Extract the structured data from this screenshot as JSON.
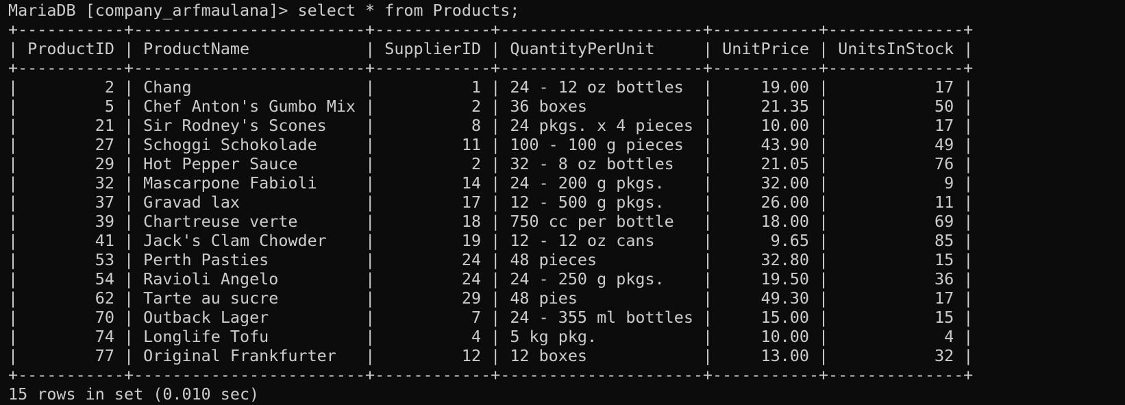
{
  "terminal": {
    "prompt": "MariaDB [company_arfmaulana]>",
    "command": "select * from Products;",
    "summary": "15 rows in set (0.010 sec)"
  },
  "table": {
    "columns": [
      {
        "name": "ProductID",
        "align": "right"
      },
      {
        "name": "ProductName",
        "align": "left"
      },
      {
        "name": "SupplierID",
        "align": "right"
      },
      {
        "name": "QuantityPerUnit",
        "align": "left"
      },
      {
        "name": "UnitPrice",
        "align": "right"
      },
      {
        "name": "UnitsInStock",
        "align": "right"
      }
    ],
    "rows": [
      [
        "2",
        "Chang",
        "1",
        "24 - 12 oz bottles",
        "19.00",
        "17"
      ],
      [
        "5",
        "Chef Anton's Gumbo Mix",
        "2",
        "36 boxes",
        "21.35",
        "50"
      ],
      [
        "21",
        "Sir Rodney's Scones",
        "8",
        "24 pkgs. x 4 pieces",
        "10.00",
        "17"
      ],
      [
        "27",
        "Schoggi Schokolade",
        "11",
        "100 - 100 g pieces",
        "43.90",
        "49"
      ],
      [
        "29",
        "Hot Pepper Sauce",
        "2",
        "32 - 8 oz bottles",
        "21.05",
        "76"
      ],
      [
        "32",
        "Mascarpone Fabioli",
        "14",
        "24 - 200 g pkgs.",
        "32.00",
        "9"
      ],
      [
        "37",
        "Gravad lax",
        "17",
        "12 - 500 g pkgs.",
        "26.00",
        "11"
      ],
      [
        "39",
        "Chartreuse verte",
        "18",
        "750 cc per bottle",
        "18.00",
        "69"
      ],
      [
        "41",
        "Jack's Clam Chowder",
        "19",
        "12 - 12 oz cans",
        "9.65",
        "85"
      ],
      [
        "53",
        "Perth Pasties",
        "24",
        "48 pieces",
        "32.80",
        "15"
      ],
      [
        "54",
        "Ravioli Angelo",
        "24",
        "24 - 250 g pkgs.",
        "19.50",
        "36"
      ],
      [
        "62",
        "Tarte au sucre",
        "29",
        "48 pies",
        "49.30",
        "17"
      ],
      [
        "70",
        "Outback Lager",
        "7",
        "24 - 355 ml bottles",
        "15.00",
        "15"
      ],
      [
        "74",
        "Longlife Tofu",
        "4",
        "5 kg pkg.",
        "10.00",
        "4"
      ],
      [
        "77",
        "Original Frankfurter",
        "12",
        "12 boxes",
        "13.00",
        "32"
      ]
    ]
  }
}
